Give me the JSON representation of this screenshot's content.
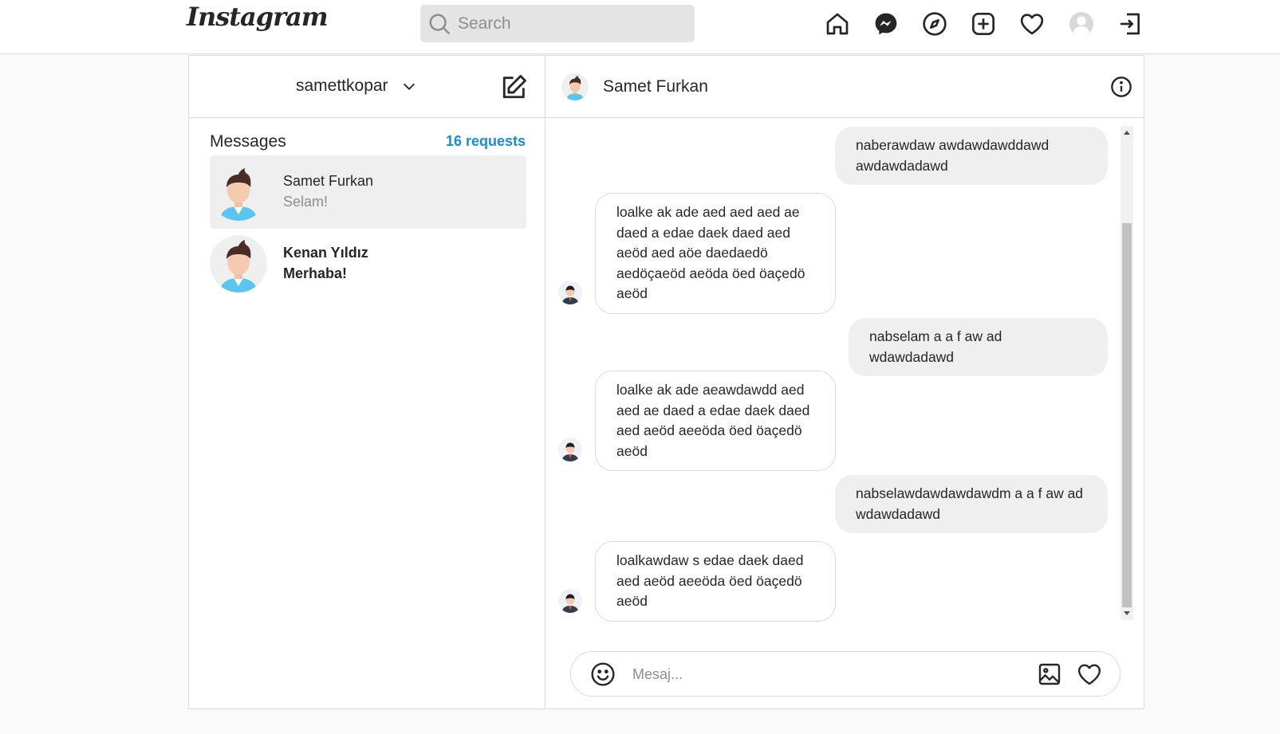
{
  "app": {
    "logo": "Instagram"
  },
  "search": {
    "placeholder": "Search"
  },
  "nav": {
    "icons": [
      "home-icon",
      "messenger-icon",
      "explore-icon",
      "new-post-icon",
      "activity-heart-icon",
      "profile-avatar",
      "logout-icon"
    ]
  },
  "sidebar": {
    "account": "samettkopar",
    "messages_title": "Messages",
    "requests_label": "16 requests",
    "conversations": [
      {
        "name": "Samet Furkan",
        "preview": "Selam!",
        "active": true,
        "unread": false
      },
      {
        "name": "Kenan Yıldız",
        "preview": "Merhaba!",
        "active": false,
        "unread": true
      }
    ]
  },
  "chat": {
    "contact_name": "Samet Furkan",
    "messages": [
      {
        "from": "me",
        "text": "naberawdaw awdawdawddawd awdawdadawd"
      },
      {
        "from": "them",
        "text": "loalke ak ade aed aed aed ae daed a edae daek daed aed aeöd aed aöe daedaedö aedöçaeöd aeöda öed öaçedö aeöd"
      },
      {
        "from": "me",
        "text": "nabselam a a f aw ad wdawdadawd"
      },
      {
        "from": "them",
        "text": "loalke ak ade aeawdawdd aed aed ae daed a edae daek daed aed aeöd aeeöda öed öaçedö aeöd"
      },
      {
        "from": "me",
        "text": "nabselawdawdawdawdm a a f aw ad wdawdadawd"
      },
      {
        "from": "them",
        "text": "loalkawdaw s edae daek daed aed aeöd aeeöda öed öaçedö aeöd"
      }
    ],
    "composer_placeholder": "Mesaj..."
  },
  "colors": {
    "accent": "#1a8cd8",
    "border": "#dbdbdb",
    "bubble_mine": "#efefef",
    "background": "#fafafa"
  }
}
